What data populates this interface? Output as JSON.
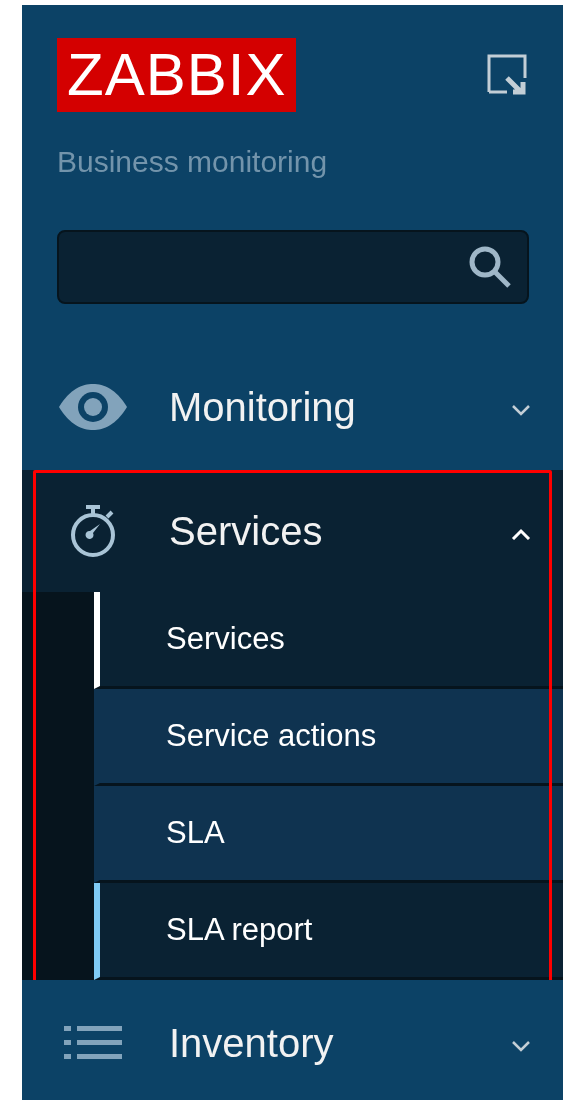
{
  "logo": {
    "text": "ZABBIX"
  },
  "subtitle": "Business monitoring",
  "menu": [
    {
      "label": "Monitoring",
      "expanded": false,
      "highlighted": false
    },
    {
      "label": "Services",
      "expanded": true,
      "highlighted": true,
      "children": [
        {
          "label": "Services",
          "selected": true,
          "hovered": false
        },
        {
          "label": "Service actions",
          "selected": false,
          "hovered": false
        },
        {
          "label": "SLA",
          "selected": false,
          "hovered": false
        },
        {
          "label": "SLA report",
          "selected": false,
          "hovered": true
        }
      ]
    },
    {
      "label": "Inventory",
      "expanded": false,
      "highlighted": false
    }
  ]
}
